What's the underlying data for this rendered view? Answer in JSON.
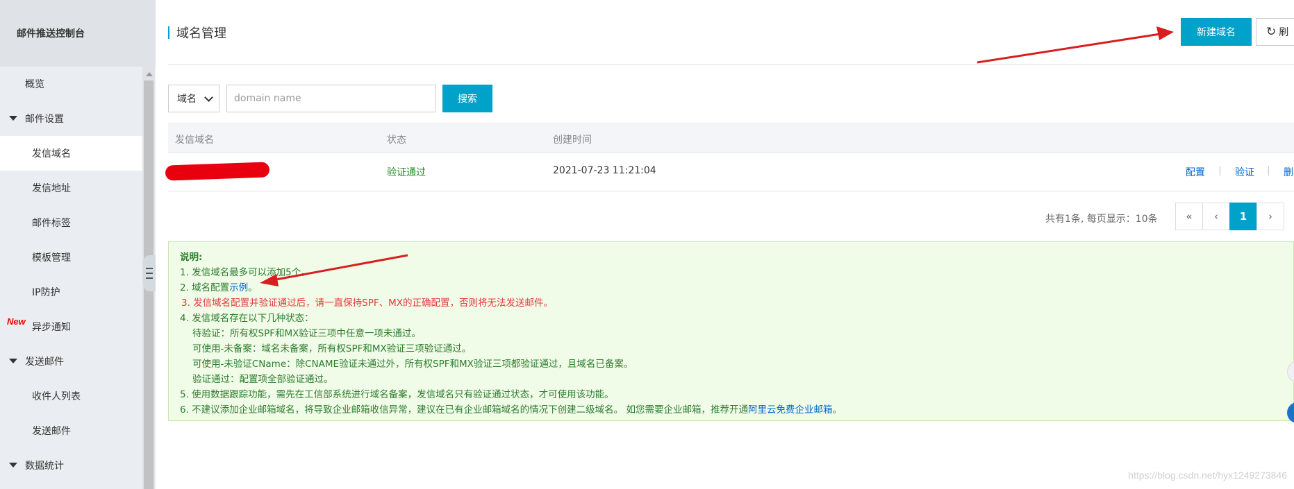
{
  "sidebar": {
    "title": "邮件推送控制台",
    "items": [
      {
        "label": "概览",
        "level": 1,
        "caret": false,
        "active": false,
        "badge": ""
      },
      {
        "label": "邮件设置",
        "level": 1,
        "caret": true,
        "active": false,
        "badge": ""
      },
      {
        "label": "发信域名",
        "level": 2,
        "caret": false,
        "active": true,
        "badge": ""
      },
      {
        "label": "发信地址",
        "level": 2,
        "caret": false,
        "active": false,
        "badge": ""
      },
      {
        "label": "邮件标签",
        "level": 2,
        "caret": false,
        "active": false,
        "badge": ""
      },
      {
        "label": "模板管理",
        "level": 2,
        "caret": false,
        "active": false,
        "badge": ""
      },
      {
        "label": "IP防护",
        "level": 2,
        "caret": false,
        "active": false,
        "badge": ""
      },
      {
        "label": "异步通知",
        "level": 2,
        "caret": false,
        "active": false,
        "badge": "New"
      },
      {
        "label": "发送邮件",
        "level": 1,
        "caret": true,
        "active": false,
        "badge": ""
      },
      {
        "label": "收件人列表",
        "level": 2,
        "caret": false,
        "active": false,
        "badge": ""
      },
      {
        "label": "发送邮件",
        "level": 2,
        "caret": false,
        "active": false,
        "badge": ""
      },
      {
        "label": "数据统计",
        "level": 1,
        "caret": true,
        "active": false,
        "badge": ""
      }
    ]
  },
  "header": {
    "title": "域名管理",
    "new_button": "新建域名",
    "refresh_button": "刷"
  },
  "search": {
    "select_value": "域名",
    "placeholder": "domain name",
    "button": "搜索"
  },
  "table": {
    "columns": [
      "发信域名",
      "状态",
      "创建时间"
    ],
    "rows": [
      {
        "domain": "",
        "status": "验证通过",
        "created": "2021-07-23 11:21:04",
        "actions": [
          "配置",
          "验证",
          "删"
        ]
      }
    ]
  },
  "pagination": {
    "summary": "共有1条, 每页显示：10条",
    "first": "«",
    "prev": "‹",
    "current": "1",
    "next": "›"
  },
  "notice": {
    "heading": "说明:",
    "line1": "1. 发信域名最多可以添加5个。",
    "line2_prefix": "2. 域名配置",
    "line2_link": "示例",
    "line2_suffix": "。",
    "line3": "3. 发信域名配置并验证通过后，请一直保持SPF、MX的正确配置，否则将无法发送邮件。",
    "line4": "4. 发信域名存在以下几种状态：",
    "status_a": "待验证：所有权SPF和MX验证三项中任意一项未通过。",
    "status_b": "可使用-未备案：域名未备案，所有权SPF和MX验证三项验证通过。",
    "status_c": "可使用-未验证CName：除CNAME验证未通过外，所有权SPF和MX验证三项都验证通过，且域名已备案。",
    "status_d": "验证通过：配置项全部验证通过。",
    "line5": "5. 使用数据跟踪功能，需先在工信部系统进行域名备案，发信域名只有验证通过状态，才可使用该功能。",
    "line6_prefix": "6. 不建议添加企业邮箱域名，将导致企业邮箱收信异常，建议在已有企业邮箱域名的情况下创建二级域名。 如您需要企业邮箱，推荐开通",
    "line6_link": "阿里云免费企业邮箱",
    "line6_suffix": "。"
  },
  "watermark": "https://blog.csdn.net/hyx1249273846",
  "colors": {
    "primary": "#00a2ca",
    "success_text": "#2a8a2a",
    "warning_text": "#e4393c",
    "notice_bg": "#f0fbe8",
    "annotation_arrow": "#d81e1e"
  }
}
